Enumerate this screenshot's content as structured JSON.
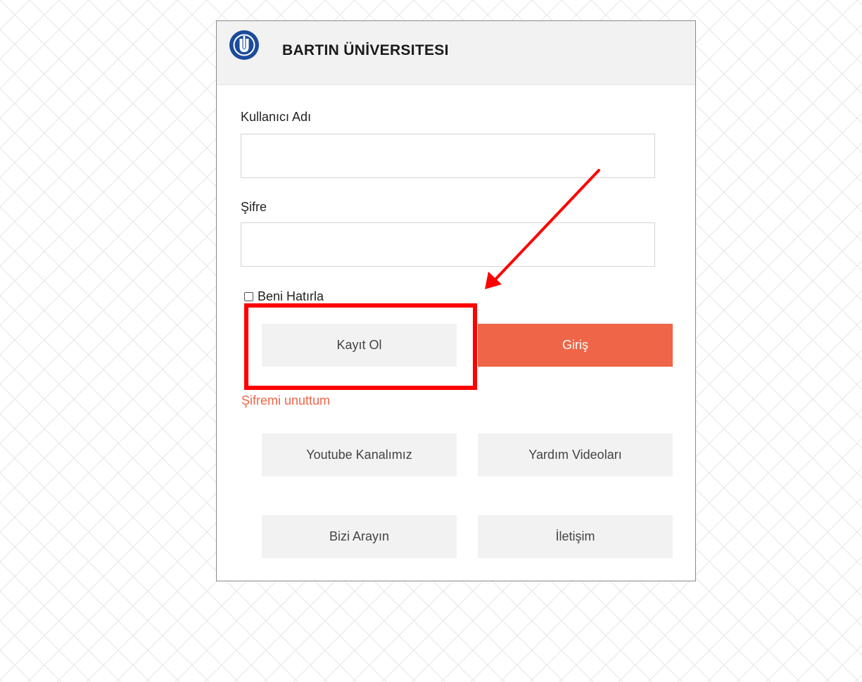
{
  "header": {
    "title": "BARTIN ÜNİVERSITESI",
    "logo_icon": "university-logo-icon"
  },
  "form": {
    "username_label": "Kullanıcı Adı",
    "username_value": "",
    "password_label": "Şifre",
    "password_value": "",
    "remember_label": "Beni Hatırla",
    "remember_checked": false,
    "register_button": "Kayıt Ol",
    "login_button": "Giriş",
    "forgot_link": "Şifremi unuttum"
  },
  "links": {
    "youtube": "Youtube Kanalımız",
    "help_videos": "Yardım Videoları",
    "call_us": "Bizi Arayın",
    "contact": "İletişim"
  },
  "colors": {
    "primary": "#ee6547",
    "annotation": "#ff0000",
    "logo_blue": "#1b4b9b"
  }
}
